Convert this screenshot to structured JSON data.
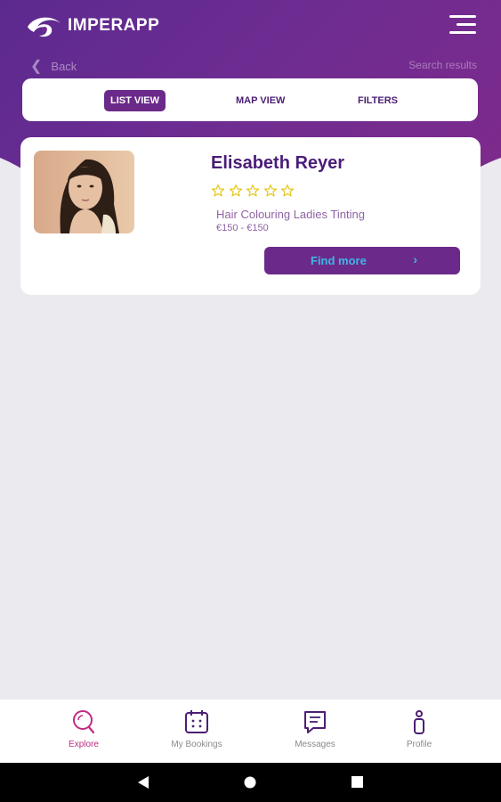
{
  "app": {
    "name": "IMPERAPP"
  },
  "header": {
    "back_label": "Back",
    "page_label": "Search results"
  },
  "tabs": [
    {
      "label": "LIST VIEW",
      "active": true
    },
    {
      "label": "MAP VIEW",
      "active": false
    },
    {
      "label": "FILTERS",
      "active": false
    }
  ],
  "result": {
    "name": "Elisabeth Reyer",
    "rating": 0,
    "rating_max": 5,
    "service": "Hair Colouring Ladies Tinting",
    "price": "€150 - €150",
    "cta_label": "Find more"
  },
  "bottom_nav": [
    {
      "label": "Explore",
      "icon": "search-icon",
      "active": true
    },
    {
      "label": "My Bookings",
      "icon": "calendar-icon",
      "active": false
    },
    {
      "label": "Messages",
      "icon": "message-icon",
      "active": false
    },
    {
      "label": "Profile",
      "icon": "profile-icon",
      "active": false
    }
  ],
  "colors": {
    "brand_purple": "#6b2a8a",
    "accent_pink": "#c22a84",
    "star_yellow": "#e6c719",
    "cta_text": "#3cb8e6"
  }
}
